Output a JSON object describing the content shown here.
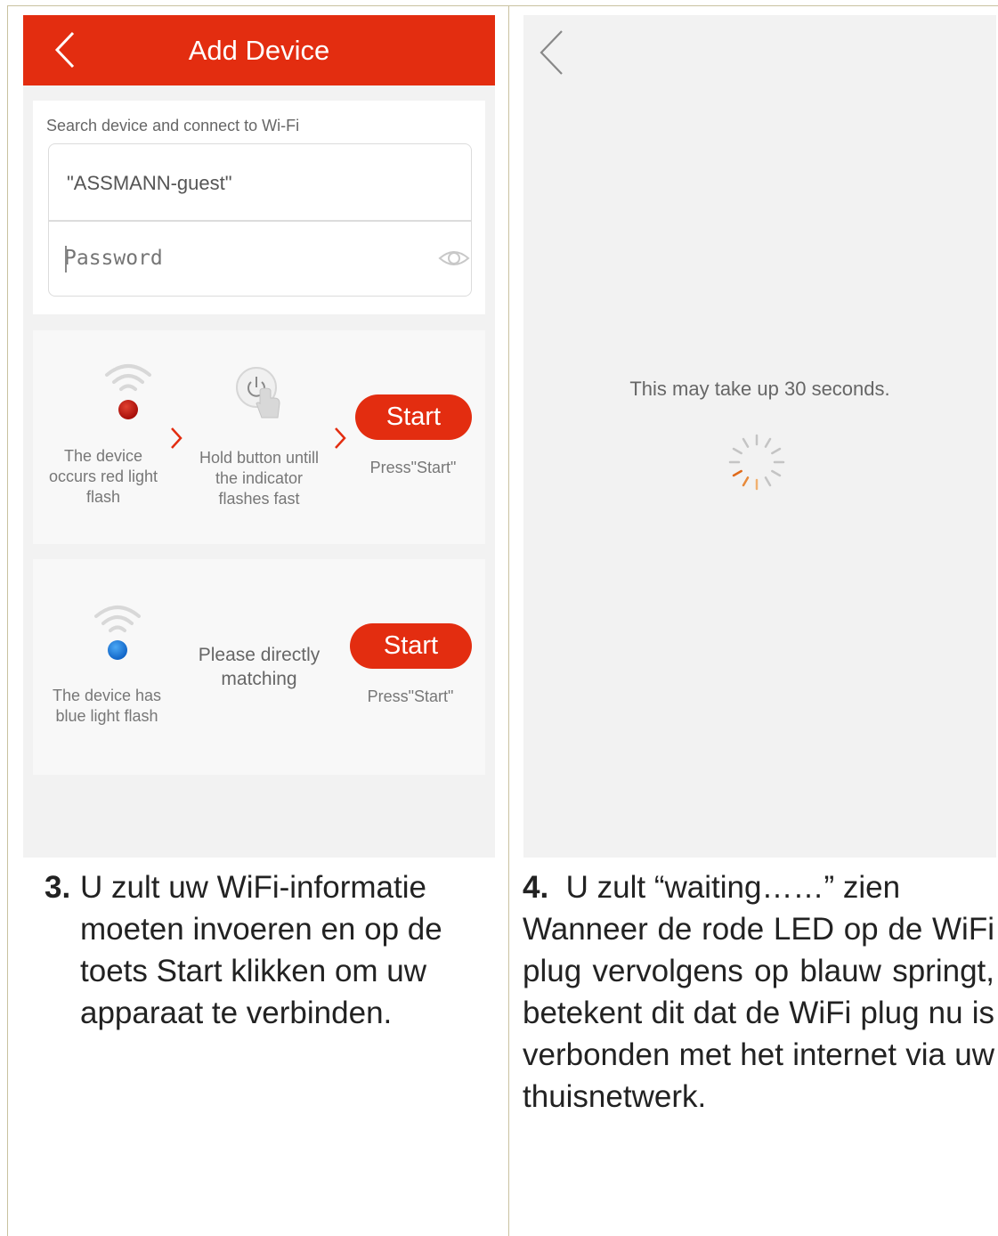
{
  "left_screen": {
    "title": "Add Device",
    "wifi": {
      "label": "Search device and connect to Wi-Fi",
      "ssid": "\"ASSMANN-guest\"",
      "password_placeholder": "Password"
    },
    "step1": {
      "red_light_text": "The device occurs red light flash",
      "hold_text": "Hold button untill the indicator flashes fast",
      "start_label": "Start",
      "press_text": "Press\"Start\""
    },
    "step2": {
      "blue_light_text": "The device has blue light flash",
      "direct_text": "Please directly matching",
      "start_label": "Start",
      "press_text": "Press\"Start\""
    }
  },
  "right_screen": {
    "wait_text": "This may take up 30 seconds."
  },
  "captions": {
    "left": {
      "number": "3.",
      "text": "U zult uw WiFi-informatie moeten invoeren en op de toets Start klikken om uw apparaat te verbinden."
    },
    "right": {
      "number": "4.",
      "first_line": "U zult “waiting……” zien",
      "text": "Wanneer de rode LED op de WiFi plug vervolgens op blauw springt, betekent dit dat de WiFi plug nu is verbonden met het internet via uw thuisnetwerk."
    }
  },
  "colors": {
    "brand_red": "#e32d10",
    "led_red": "#b01810",
    "led_blue": "#1a73d0"
  }
}
